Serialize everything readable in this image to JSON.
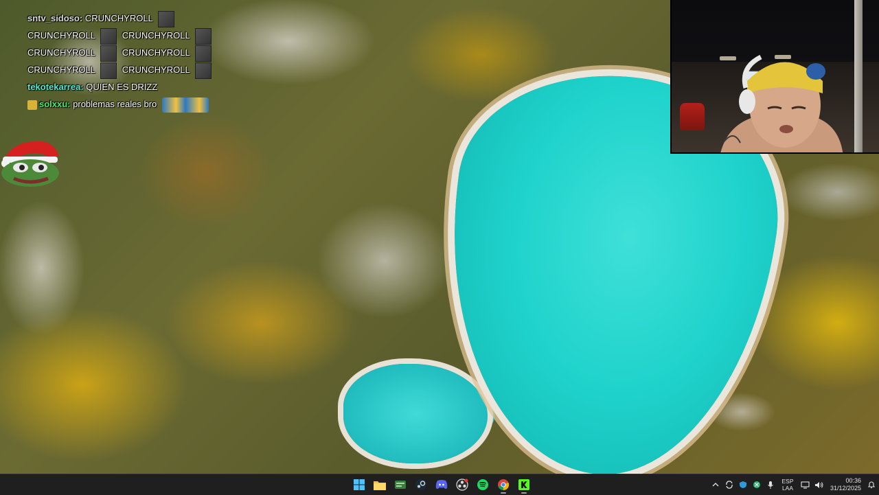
{
  "chat": {
    "top_partial": "",
    "lines": [
      {
        "user": "sntv_sidoso:",
        "message": "CRUNCHYROLL",
        "emotes_after": 1
      },
      {
        "user": "",
        "message": "CRUNCHYROLL",
        "emote": "CRUNCHYROLL"
      },
      {
        "user": "",
        "message": "CRUNCHYROLL",
        "emote": "CRUNCHYROLL"
      },
      {
        "user": "",
        "message": "CRUNCHYROLL",
        "emote": "CRUNCHYROLL"
      },
      {
        "user": "tekotekarrea:",
        "message": "QUIEN ES DRIZZ"
      },
      {
        "user": "solxxu:",
        "message": "problemas reales bro"
      }
    ],
    "line2": "CRUNCHYROLL",
    "line2b": "CRUNCHYROLL",
    "line3": "CRUNCHYROLL",
    "line3b": "CRUNCHYROLL",
    "line4": "CRUNCHYROLL",
    "line4b": "CRUNCHYROLL",
    "user1": "sntv_sidoso:",
    "msg1": "CRUNCHYROLL",
    "user5": "tekotekarrea:",
    "msg5": "QUIEN ES DRIZZ",
    "user6": "solxxu:",
    "msg6": "problemas reales bro"
  },
  "taskbar": {
    "apps": [
      "start",
      "file-explorer",
      "game-launcher",
      "steam",
      "discord",
      "obs",
      "spotify",
      "chrome",
      "kick"
    ],
    "language_line1": "ESP",
    "language_line2": "LAA",
    "time": "00:36",
    "date": "31/12/2025"
  },
  "colors": {
    "lake": "#1fd3cc",
    "taskbar": "#1f1f1f",
    "chat_user_green": "#3df06a"
  }
}
